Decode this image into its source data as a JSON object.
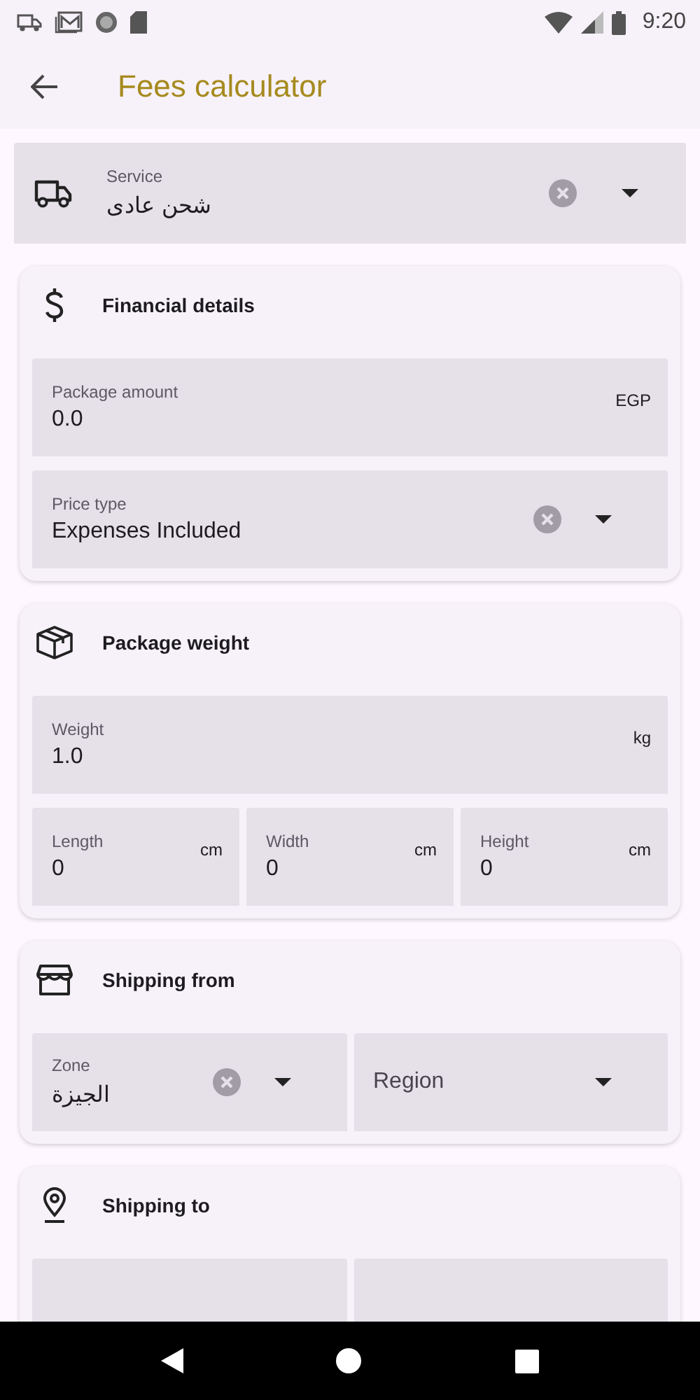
{
  "status_bar": {
    "time": "9:20"
  },
  "app_bar": {
    "title": "Fees calculator"
  },
  "service": {
    "label": "Service",
    "value": "شحن عادى",
    "clearable": true
  },
  "sections": [
    {
      "title": "Financial details",
      "rows": [
        [
          {
            "kind": "text",
            "label": "Package amount",
            "value": "0.0",
            "suffix": "EGP"
          }
        ],
        [
          {
            "kind": "dropdown",
            "label": "Price type",
            "value": "Expenses Included",
            "clearable": true
          }
        ]
      ]
    },
    {
      "title": "Package weight",
      "rows": [
        [
          {
            "kind": "text",
            "label": "Weight",
            "value": "1.0",
            "suffix": "kg"
          }
        ],
        [
          {
            "kind": "text",
            "label": "Length",
            "value": "0",
            "suffix": "cm"
          },
          {
            "kind": "text",
            "label": "Width",
            "value": "0",
            "suffix": "cm"
          },
          {
            "kind": "text",
            "label": "Height",
            "value": "0",
            "suffix": "cm"
          }
        ]
      ]
    },
    {
      "title": "Shipping from",
      "rows": [
        [
          {
            "kind": "dropdown",
            "label": "Zone",
            "value": "الجيزة",
            "clearable": true
          },
          {
            "kind": "dropdown",
            "placeholder": "Region",
            "clearable": false
          }
        ]
      ]
    },
    {
      "title": "Shipping to",
      "rows": [
        [
          {
            "kind": "blank"
          },
          {
            "kind": "blank"
          }
        ]
      ]
    }
  ]
}
